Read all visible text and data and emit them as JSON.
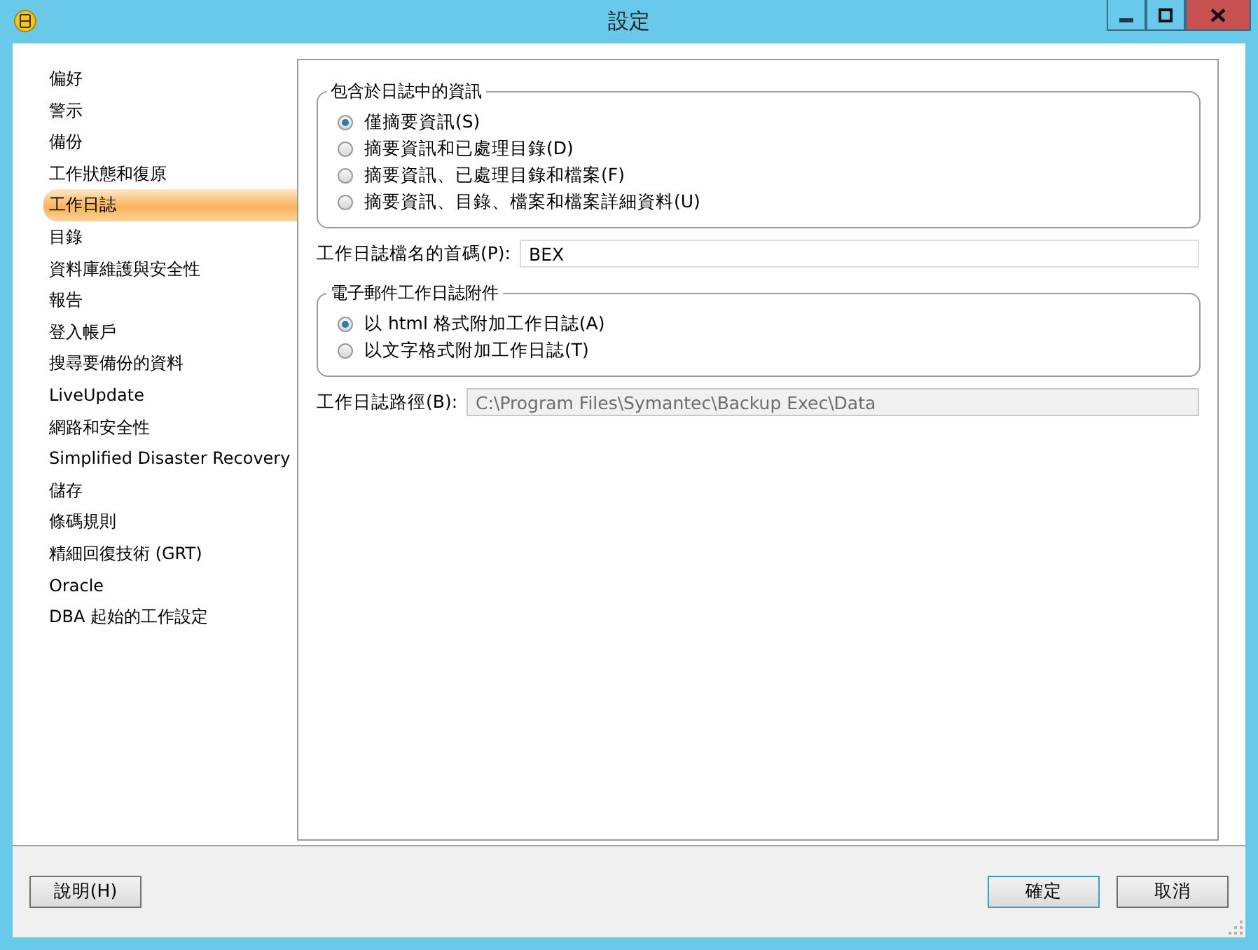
{
  "window": {
    "title": "設定"
  },
  "sidebar": {
    "items": [
      {
        "label": "偏好",
        "selected": false
      },
      {
        "label": "警示",
        "selected": false
      },
      {
        "label": "備份",
        "selected": false
      },
      {
        "label": "工作狀態和復原",
        "selected": false
      },
      {
        "label": "工作日誌",
        "selected": true
      },
      {
        "label": "目錄",
        "selected": false
      },
      {
        "label": "資料庫維護與安全性",
        "selected": false
      },
      {
        "label": "報告",
        "selected": false
      },
      {
        "label": "登入帳戶",
        "selected": false
      },
      {
        "label": "搜尋要備份的資料",
        "selected": false
      },
      {
        "label": "LiveUpdate",
        "selected": false
      },
      {
        "label": "網路和安全性",
        "selected": false
      },
      {
        "label": "Simplified Disaster Recovery",
        "selected": false
      },
      {
        "label": "儲存",
        "selected": false
      },
      {
        "label": "條碼規則",
        "selected": false
      },
      {
        "label": "精細回復技術 (GRT)",
        "selected": false
      },
      {
        "label": "Oracle",
        "selected": false
      },
      {
        "label": "DBA 起始的工作設定",
        "selected": false
      }
    ]
  },
  "panel": {
    "log_content": {
      "title": "包含於日誌中的資訊",
      "options": [
        {
          "label": "僅摘要資訊(S)",
          "selected": true
        },
        {
          "label": "摘要資訊和已處理目錄(D)",
          "selected": false
        },
        {
          "label": "摘要資訊、已處理目錄和檔案(F)",
          "selected": false
        },
        {
          "label": "摘要資訊、目錄、檔案和檔案詳細資料(U)",
          "selected": false
        }
      ]
    },
    "prefix": {
      "label": "工作日誌檔名的首碼(P):",
      "value": "BEX"
    },
    "email_attachment": {
      "title": "電子郵件工作日誌附件",
      "options": [
        {
          "label": "以 html 格式附加工作日誌(A)",
          "selected": true
        },
        {
          "label": "以文字格式附加工作日誌(T)",
          "selected": false
        }
      ]
    },
    "path": {
      "label": "工作日誌路徑(B):",
      "value": "C:\\Program Files\\Symantec\\Backup Exec\\Data",
      "disabled": true
    }
  },
  "buttons": {
    "help": "說明(H)",
    "ok": "確定",
    "cancel": "取消"
  }
}
